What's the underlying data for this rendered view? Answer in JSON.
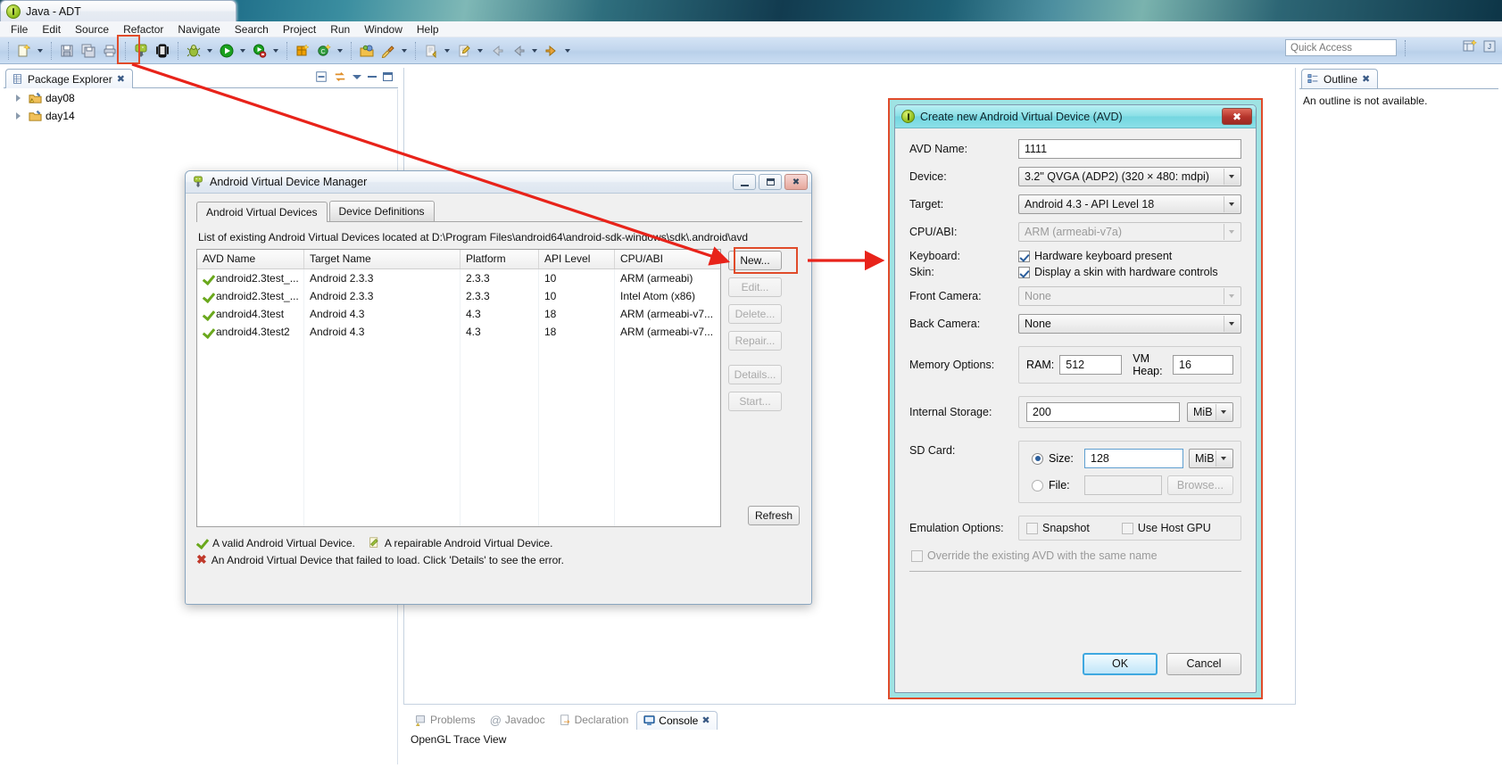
{
  "window": {
    "title": "Java - ADT",
    "title_icon": "eclipse-icon"
  },
  "menubar": {
    "items": [
      "File",
      "Edit",
      "Source",
      "Refactor",
      "Navigate",
      "Search",
      "Project",
      "Run",
      "Window",
      "Help"
    ]
  },
  "toolbar": {
    "icons": [
      "new-wizard-icon",
      "save-icon",
      "save-all-icon",
      "print-icon",
      "android-sdk-manager-icon",
      "android-avd-manager-icon",
      "debug-icon",
      "run-icon",
      "run-configurations-icon",
      "new-android-project-icon",
      "new-class-icon",
      "open-type-icon",
      "search-icon",
      "next-annotation-icon",
      "previous-edit-icon",
      "back-icon",
      "forward-icon"
    ]
  },
  "quick_access": {
    "placeholder": "Quick Access",
    "value": ""
  },
  "package_explorer": {
    "tab_label": "Package Explorer",
    "tab_icon": "package-explorer-icon",
    "close_icon": "close-icon",
    "toolbar_icons": [
      "collapse-all-icon",
      "link-with-editor-icon",
      "view-menu-icon",
      "minimize-icon",
      "maximize-icon"
    ],
    "items": [
      {
        "label": "day08",
        "icon": "java-project-warning-icon"
      },
      {
        "label": "day14",
        "icon": "java-project-icon"
      }
    ]
  },
  "outline": {
    "tab_label": "Outline",
    "tab_icon": "outline-icon",
    "close_icon": "close-icon",
    "message": "An outline is not available."
  },
  "console": {
    "tabs": [
      {
        "label": "Problems",
        "icon": "problems-icon",
        "active": false
      },
      {
        "label": "Javadoc",
        "icon": "javadoc-icon",
        "active": false
      },
      {
        "label": "Declaration",
        "icon": "declaration-icon",
        "active": false
      },
      {
        "label": "Console",
        "icon": "console-icon",
        "active": true
      }
    ],
    "close_icon": "close-icon",
    "body_text": "OpenGL Trace View"
  },
  "avd_manager": {
    "title": "Android Virtual Device Manager",
    "title_icon": "android-icon",
    "window_buttons": [
      "minimize-icon",
      "maximize-icon",
      "close-icon"
    ],
    "tabs": [
      {
        "label": "Android Virtual Devices",
        "active": true
      },
      {
        "label": "Device Definitions",
        "active": false
      }
    ],
    "list_label": "List of existing Android Virtual Devices located at D:\\Program Files\\android64\\android-sdk-windows\\sdk\\.android\\avd",
    "columns": [
      "AVD Name",
      "Target Name",
      "Platform",
      "API Level",
      "CPU/ABI"
    ],
    "rows": [
      {
        "status_icon": "valid-check-icon",
        "name": "android2.3test_...",
        "target": "Android 2.3.3",
        "platform": "2.3.3",
        "api": "10",
        "abi": "ARM (armeabi)"
      },
      {
        "status_icon": "valid-check-icon",
        "name": "android2.3test_...",
        "target": "Android 2.3.3",
        "platform": "2.3.3",
        "api": "10",
        "abi": "Intel Atom (x86)"
      },
      {
        "status_icon": "valid-check-icon",
        "name": "android4.3test",
        "target": "Android 4.3",
        "platform": "4.3",
        "api": "18",
        "abi": "ARM (armeabi-v7..."
      },
      {
        "status_icon": "valid-check-icon",
        "name": "android4.3test2",
        "target": "Android 4.3",
        "platform": "4.3",
        "api": "18",
        "abi": "ARM (armeabi-v7..."
      }
    ],
    "buttons": [
      {
        "label": "New...",
        "enabled": true
      },
      {
        "label": "Edit...",
        "enabled": false
      },
      {
        "label": "Delete...",
        "enabled": false
      },
      {
        "label": "Repair...",
        "enabled": false
      },
      {
        "label": "Details...",
        "enabled": false
      },
      {
        "label": "Start...",
        "enabled": false
      }
    ],
    "refresh_label": "Refresh",
    "legend": [
      {
        "icon": "valid-check-icon",
        "text": "A valid Android Virtual Device."
      },
      {
        "icon": "repairable-icon",
        "text": "A repairable Android Virtual Device."
      },
      {
        "icon": "failed-x-icon",
        "text": "An Android Virtual Device that failed to load. Click 'Details' to see the error."
      }
    ]
  },
  "create_avd": {
    "title": "Create new Android Virtual Device (AVD)",
    "title_icon": "info-icon",
    "close_icon": "close-icon",
    "fields": {
      "avd_name_label": "AVD Name:",
      "avd_name_value": "1111",
      "device_label": "Device:",
      "device_value": "3.2\" QVGA (ADP2) (320 × 480: mdpi)",
      "target_label": "Target:",
      "target_value": "Android 4.3 - API Level 18",
      "cpu_abi_label": "CPU/ABI:",
      "cpu_abi_value": "ARM (armeabi-v7a)",
      "keyboard_label": "Keyboard:",
      "keyboard_checkbox": "Hardware keyboard present",
      "keyboard_checked": true,
      "skin_label": "Skin:",
      "skin_checkbox": "Display a skin with hardware controls",
      "skin_checked": true,
      "front_camera_label": "Front Camera:",
      "front_camera_value": "None",
      "back_camera_label": "Back Camera:",
      "back_camera_value": "None",
      "memory_options_label": "Memory Options:",
      "ram_label": "RAM:",
      "ram_value": "512",
      "vm_heap_label": "VM Heap:",
      "vm_heap_value": "16",
      "internal_storage_label": "Internal Storage:",
      "internal_storage_value": "200",
      "internal_storage_unit": "MiB",
      "sd_card_label": "SD Card:",
      "sd_size_radio_label": "Size:",
      "sd_size_value": "128",
      "sd_size_unit": "MiB",
      "sd_file_radio_label": "File:",
      "sd_file_value": "",
      "browse_label": "Browse...",
      "emulation_options_label": "Emulation Options:",
      "snapshot_label": "Snapshot",
      "snapshot_checked": false,
      "host_gpu_label": "Use Host GPU",
      "host_gpu_checked": false,
      "override_label": "Override the existing AVD with the same name",
      "override_checked": false
    },
    "ok_label": "OK",
    "cancel_label": "Cancel"
  },
  "annotations": {
    "arrow_color": "#e8231a",
    "highlight_color": "#e04b2a"
  }
}
